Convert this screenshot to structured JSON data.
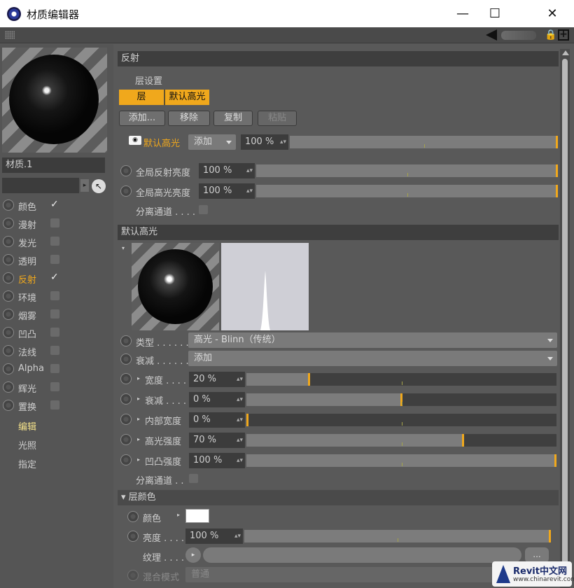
{
  "window": {
    "title": "材质编辑器",
    "min": "—",
    "max": "☐",
    "close": "✕"
  },
  "toolbar": {
    "lock": "🔒",
    "new": "+"
  },
  "left": {
    "material_name": "材质.1",
    "channels": [
      {
        "label": "颜色",
        "checked": true
      },
      {
        "label": "漫射",
        "checked": false
      },
      {
        "label": "发光",
        "checked": false
      },
      {
        "label": "透明",
        "checked": false
      },
      {
        "label": "反射",
        "checked": true,
        "active": true
      },
      {
        "label": "环境",
        "checked": false
      },
      {
        "label": "烟雾",
        "checked": false
      },
      {
        "label": "凹凸",
        "checked": false
      },
      {
        "label": "法线",
        "checked": false
      },
      {
        "label": "Alpha",
        "checked": false
      },
      {
        "label": "辉光",
        "checked": false
      },
      {
        "label": "置换",
        "checked": false
      }
    ],
    "extras": [
      "编辑",
      "光照",
      "指定"
    ],
    "checkmark": "✓",
    "arrow": "▸",
    "picker": "↖"
  },
  "reflect": {
    "header": "反射",
    "layer_settings": "层设置",
    "tabs": [
      "层",
      "默认高光"
    ],
    "buttons": [
      "添加...",
      "移除",
      "复制",
      "粘贴"
    ],
    "eye_icon": "◉",
    "layer_name": "默认高光",
    "blend_mode": "添加",
    "layer_opacity": "100 %",
    "layer_opacity_value": 1.0,
    "global_reflect_label": "全局反射亮度",
    "global_reflect_value": "100 %",
    "global_reflect_level": 1.0,
    "global_spec_label": "全局高光亮度",
    "global_spec_value": "100 %",
    "global_spec_level": 1.0,
    "separate_pass": "分离通道 . . . ."
  },
  "spec": {
    "header": "默认高光",
    "collapse": "▾",
    "type_label": "类型 . . . . . .",
    "type_value": "高光 - Blinn（传统）",
    "falloff_label": "衰减 . . . . . .",
    "falloff_value": "添加",
    "params": [
      {
        "label": "宽度 . . . .",
        "value": "20 %",
        "level": 0.2
      },
      {
        "label": "衰减 . . . .",
        "value": "0 %",
        "level": 0.5
      },
      {
        "label": "内部宽度",
        "value": "0 %",
        "level": 0.0
      },
      {
        "label": "高光强度",
        "value": "70 %",
        "level": 0.7
      },
      {
        "label": "凹凸强度",
        "value": "100 %",
        "level": 1.0
      }
    ],
    "separate_pass": "分离通道 . ."
  },
  "layer_color": {
    "header": "▾ 层颜色",
    "color_label": "颜色",
    "color_value": "#ffffff",
    "brightness_label": "亮度 . . . .",
    "brightness_value": "100 %",
    "brightness_level": 1.0,
    "texture_label": "纹理 . . . .",
    "texture_btn": "▸",
    "dots": "...",
    "blend_label": "混合模式",
    "blend_value": "普通"
  },
  "watermark": {
    "main": "Revit中文网",
    "sub": "www.chinarevit.com"
  },
  "colors": {
    "accent": "#f0a81c",
    "panel": "#595959",
    "field": "#3c3c3c"
  }
}
